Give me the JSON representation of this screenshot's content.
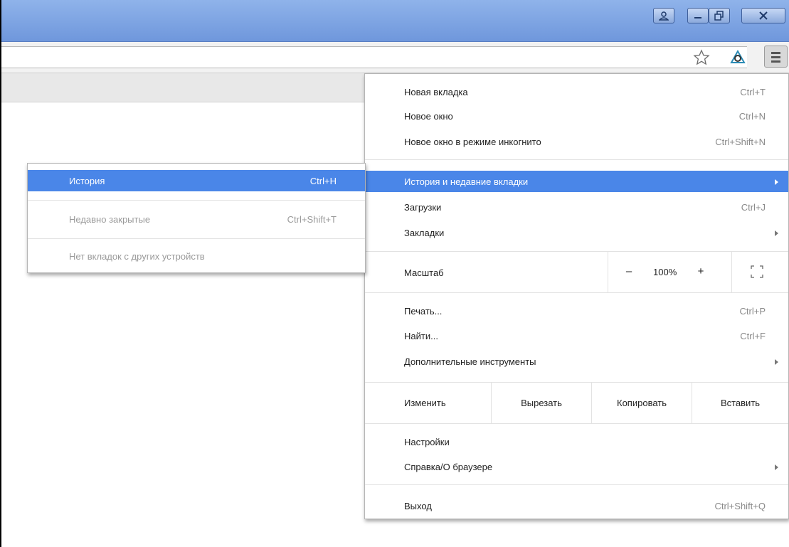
{
  "window_controls": {
    "profile_icon": "person-icon",
    "minimize_icon": "minimize-icon",
    "restore_icon": "restore-icon",
    "close_icon": "close-icon"
  },
  "toolbar": {
    "bookmark_icon": "star-icon",
    "extension_icon": "extension-icon",
    "menu_icon": "hamburger-menu-icon"
  },
  "main_menu": {
    "new_tab": {
      "label": "Новая вкладка",
      "shortcut": "Ctrl+T"
    },
    "new_window": {
      "label": "Новое окно",
      "shortcut": "Ctrl+N"
    },
    "incognito": {
      "label": "Новое окно в режиме инкогнито",
      "shortcut": "Ctrl+Shift+N"
    },
    "history": {
      "label": "История и недавние вкладки"
    },
    "downloads": {
      "label": "Загрузки",
      "shortcut": "Ctrl+J"
    },
    "bookmarks": {
      "label": "Закладки"
    },
    "zoom": {
      "label": "Масштаб",
      "minus": "–",
      "value": "100%",
      "plus": "+"
    },
    "print": {
      "label": "Печать...",
      "shortcut": "Ctrl+P"
    },
    "find": {
      "label": "Найти...",
      "shortcut": "Ctrl+F"
    },
    "more_tools": {
      "label": "Дополнительные инструменты"
    },
    "edit": {
      "label": "Изменить",
      "cut": "Вырезать",
      "copy": "Копировать",
      "paste": "Вставить"
    },
    "settings": {
      "label": "Настройки"
    },
    "help": {
      "label": "Справка/О браузере"
    },
    "exit": {
      "label": "Выход",
      "shortcut": "Ctrl+Shift+Q"
    }
  },
  "history_submenu": {
    "history": {
      "label": "История",
      "shortcut": "Ctrl+H"
    },
    "recently_closed": {
      "label": "Недавно закрытые",
      "shortcut": "Ctrl+Shift+T"
    },
    "no_tabs": {
      "label": "Нет вкладок с других устройств"
    }
  },
  "colors": {
    "highlight": "#4a86e8",
    "titlebar": "#7fa4e3",
    "disabled_text": "#9a9a9a",
    "shortcut_text": "#8a8a8a"
  }
}
